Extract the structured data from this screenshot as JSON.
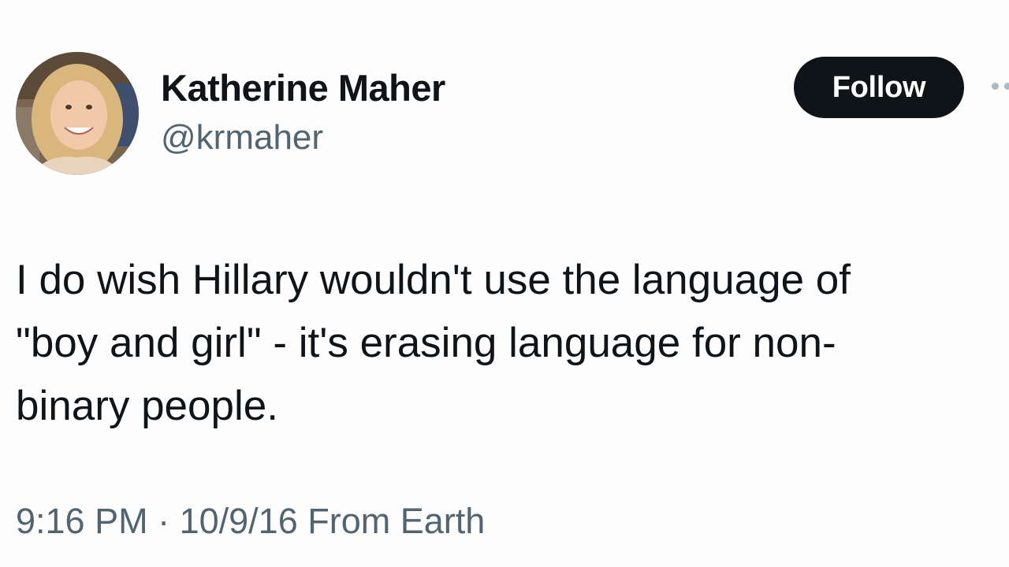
{
  "author": {
    "display_name": "Katherine Maher",
    "handle": "@krmaher"
  },
  "follow_button": {
    "label": "Follow"
  },
  "tweet": {
    "lines": [
      "I do wish Hillary wouldn't use the language of",
      "\"boy and girl\" - it's erasing language for non-",
      "binary people."
    ],
    "timestamp": "9:16 PM · 10/9/16 From Earth"
  },
  "icons": {
    "more": "more-dots-icon"
  }
}
